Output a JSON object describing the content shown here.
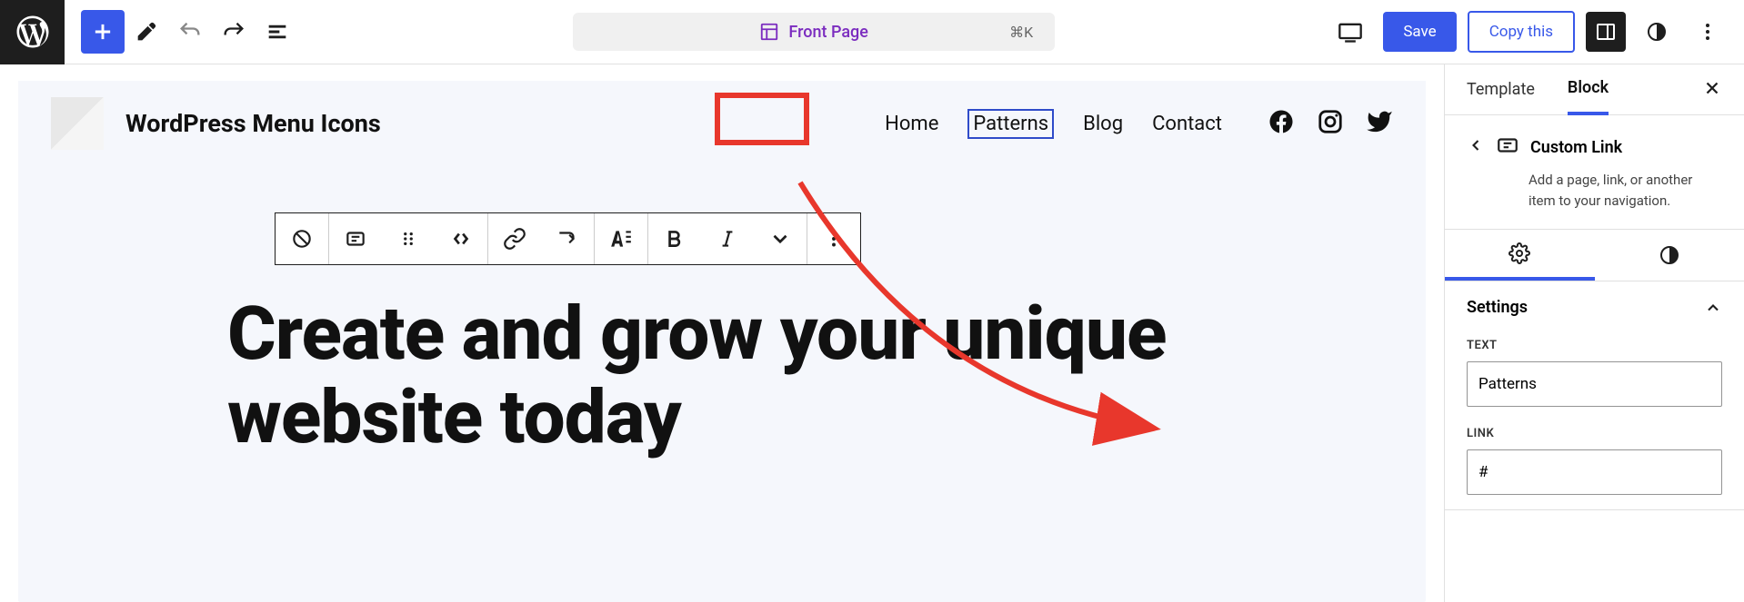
{
  "topbar": {
    "doc_title": "Front Page",
    "shortcut": "⌘K",
    "save_label": "Save",
    "copy_label": "Copy this"
  },
  "site": {
    "title": "WordPress Menu Icons",
    "nav": [
      "Home",
      "Patterns",
      "Blog",
      "Contact"
    ],
    "selected_nav_index": 1
  },
  "hero": {
    "heading": "Create and grow your unique website today"
  },
  "sidebar": {
    "tabs": [
      "Template",
      "Block"
    ],
    "active_tab_index": 1,
    "block_name": "Custom Link",
    "block_desc": "Add a page, link, or another item to your navigation.",
    "panel_title": "Settings",
    "fields": {
      "text_label": "TEXT",
      "text_value": "Patterns",
      "link_label": "LINK",
      "link_value": "#"
    }
  }
}
